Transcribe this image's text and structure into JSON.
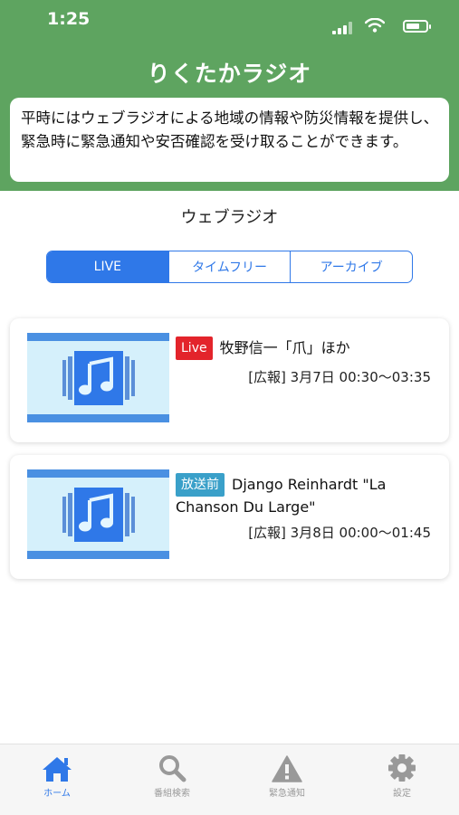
{
  "status_bar": {
    "time": "1:25"
  },
  "header": {
    "title": "りくたかラジオ",
    "notice": "平時にはウェブラジオによる地域の情報や防災情報を提供し、緊急時に緊急通知や安否確認を受け取ることができます。"
  },
  "section": {
    "title": "ウェブラジオ"
  },
  "segments": [
    {
      "label": "LIVE",
      "active": true
    },
    {
      "label": "タイムフリー",
      "active": false
    },
    {
      "label": "アーカイブ",
      "active": false
    }
  ],
  "programs": [
    {
      "badge": "Live",
      "title": "牧野信一「爪」ほか",
      "meta": "[広報] 3月7日 00:30〜03:35",
      "thumbnail_icon": "music-note-icon"
    },
    {
      "badge": "放送前",
      "title": "Django Reinhardt \"La Chanson Du Large\"",
      "meta": "[広報] 3月8日 00:00〜01:45",
      "thumbnail_icon": "music-note-icon"
    }
  ],
  "tabbar": [
    {
      "label": "ホーム",
      "icon": "home-icon",
      "active": true
    },
    {
      "label": "番組検索",
      "icon": "search-icon",
      "active": false
    },
    {
      "label": "緊急通知",
      "icon": "warning-icon",
      "active": false
    },
    {
      "label": "設定",
      "icon": "gear-icon",
      "active": false
    }
  ],
  "colors": {
    "header_green": "#5ea460",
    "accent_blue": "#2f78e8",
    "live_red": "#e3242b",
    "pre_broadcast_blue": "#3aa0c9"
  }
}
